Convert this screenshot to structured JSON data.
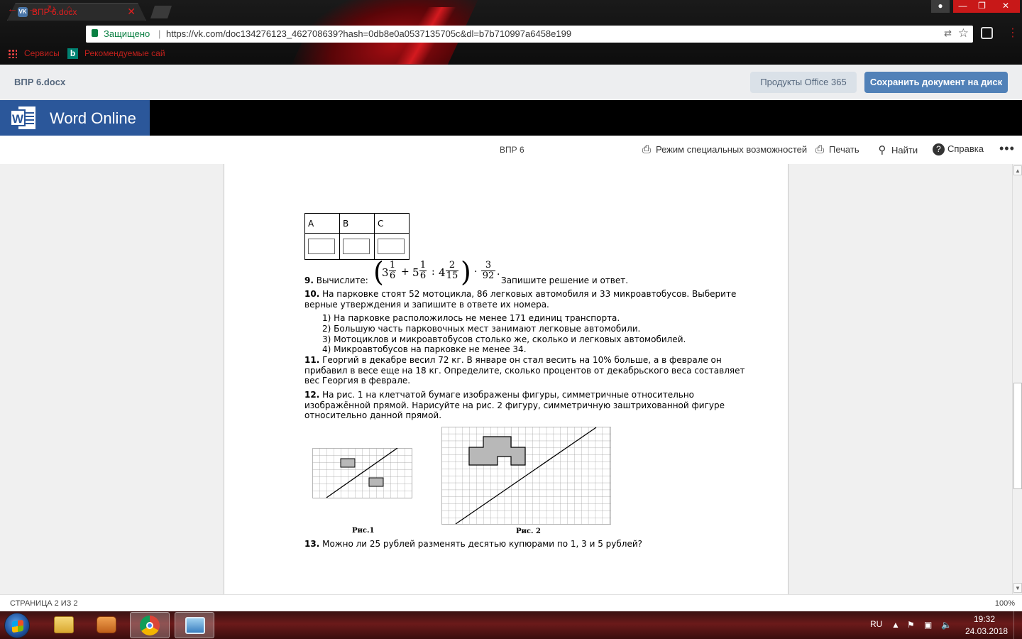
{
  "browser": {
    "tab_title": "ВПР 6.docx",
    "tab_close": "✕",
    "security_label": "Защищено",
    "url": "https://vk.com/doc134276123_462708639?hash=0db8e0a0537135705c&dl=b7b710997a6458e199",
    "bookmarks": [
      "Сервисы",
      "Рекомендуемые сай"
    ],
    "window_controls": [
      "user-icon",
      "minimize-icon",
      "restore-icon",
      "close-icon"
    ]
  },
  "vk": {
    "doc_name": "ВПР 6.docx",
    "office_button": "Продукты Office 365",
    "save_button": "Сохранить документ на диск"
  },
  "word": {
    "app_name": "Word Online",
    "doc_title": "ВПР 6",
    "toolbar": {
      "accessibility": "Режим специальных возможностей",
      "print": "Печать",
      "find": "Найти",
      "help": "Справка"
    }
  },
  "document": {
    "answer_table": {
      "headers": [
        "А",
        "В",
        "С"
      ]
    },
    "q9": {
      "num": "9.",
      "prefix": "Вычислите:",
      "suffix": "Запишите решение и ответ.",
      "formula": {
        "whole1": "3",
        "n1": "1",
        "d1": "6",
        "op1": "+",
        "whole2": "5",
        "n2": "1",
        "d2": "6",
        "op2": ":",
        "whole3": "4",
        "n3": "2",
        "d3": "15",
        "op3": "·",
        "n4": "3",
        "d4": "92",
        "end": "."
      }
    },
    "q10": {
      "num": "10.",
      "text_line1": "На парковке стоят 52 мотоцикла, 86 легковых автомобиля и 33 микроавтобусов. Выберите",
      "text_line2": "верные утверждения и запишите в ответе их номера.",
      "options": [
        "1) На парковке расположилось не менее 171 единиц транспорта.",
        "2) Большую часть парковочных мест занимают легковые автомобили.",
        "3) Мотоциклов и микроавтобусов столько же, сколько и легковых автомобилей.",
        "4) Микроавтобусов на парковке не менее 34."
      ]
    },
    "q11": {
      "num": "11.",
      "line1": "Георгий в декабре весил 72 кг. В январе он стал весить на 10% больше, а в феврале он",
      "line2": "прибавил в весе еще на 18 кг. Определите, сколько процентов от декабрьского веса составляет",
      "line3": "вес Георгия в феврале."
    },
    "q12": {
      "num": "12.",
      "line1": "На рис. 1 на клетчатой бумаге изображены фигуры, симметричные относительно",
      "line2": "изображённой прямой. Нарисуйте на рис. 2 фигуру, симметричную заштрихованной фигуре",
      "line3": "относительно данной прямой.",
      "fig1_caption": "Рис.1",
      "fig2_caption": "Рис. 2"
    },
    "q13": {
      "num": "13.",
      "text": "Можно ли 25 рублей разменять десятью купюрами по 1, 3 и 5 рублей?"
    }
  },
  "status": {
    "page": "СТРАНИЦА 2 ИЗ 2",
    "zoom": "100%"
  },
  "taskbar": {
    "apps": [
      "explorer-icon",
      "media-player-icon",
      "chrome-icon",
      "image-viewer-icon"
    ],
    "language": "RU",
    "time": "19:32",
    "date": "24.03.2018"
  },
  "colors": {
    "word_blue": "#2b579a",
    "vk_blue": "#5181b8",
    "chrome_red": "#c81818",
    "figure_fill": "#b8b8b8"
  }
}
